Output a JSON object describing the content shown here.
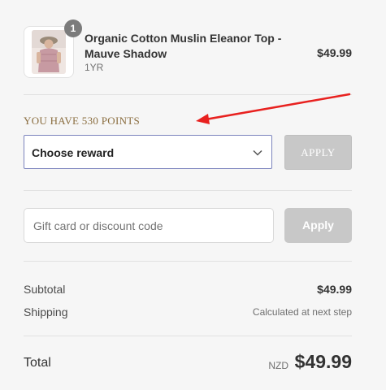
{
  "product": {
    "quantity": "1",
    "title": "Organic Cotton Muslin Eleanor Top - Mauve Shadow",
    "variant": "1YR",
    "price": "$49.99"
  },
  "points": {
    "label": "YOU HAVE 530 POINTS",
    "select_value": "Choose reward",
    "apply_label": "APPLY"
  },
  "discount": {
    "placeholder": "Gift card or discount code",
    "apply_label": "Apply"
  },
  "summary": {
    "subtotal_label": "Subtotal",
    "subtotal_value": "$49.99",
    "shipping_label": "Shipping",
    "shipping_value": "Calculated at next step",
    "total_label": "Total",
    "currency": "NZD",
    "total_value": "$49.99"
  },
  "colors": {
    "annotation_arrow": "#e8211f",
    "points_label": "#8a6d3f",
    "disabled_button": "#c8c8c8"
  }
}
